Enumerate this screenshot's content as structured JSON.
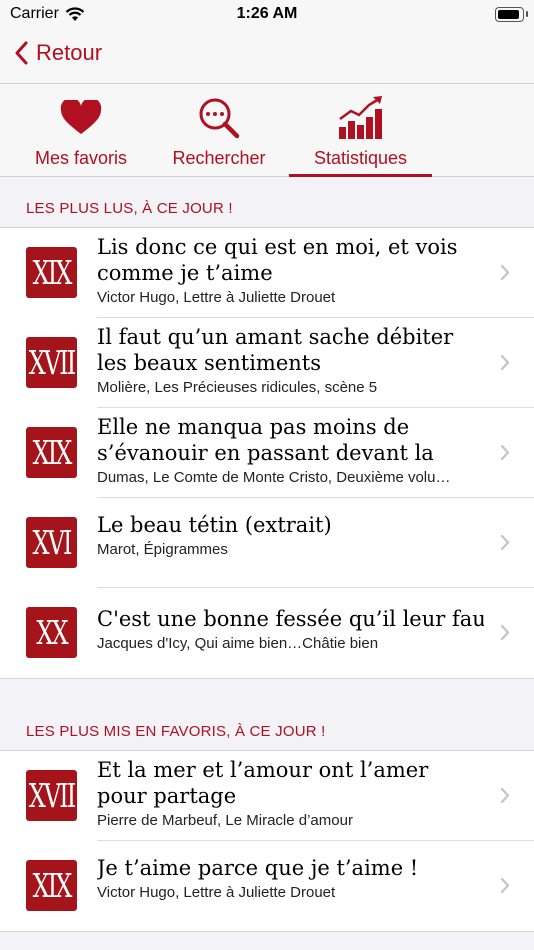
{
  "status": {
    "carrier": "Carrier",
    "time": "1:26 AM"
  },
  "nav": {
    "back_label": "Retour"
  },
  "tabs": [
    {
      "label": "Mes favoris",
      "icon": "heart-icon"
    },
    {
      "label": "Rechercher",
      "icon": "search-icon"
    },
    {
      "label": "Statistiques",
      "icon": "stats-icon",
      "selected": true
    }
  ],
  "colors": {
    "accent": "#b01020",
    "badge": "#a5141a"
  },
  "sections": [
    {
      "header": "LES PLUS LUS, À CE JOUR !",
      "items": [
        {
          "badge": "XIX",
          "title": "Lis donc ce qui est en moi, et vois comme je t’aime",
          "subtitle": "Victor Hugo, Lettre à Juliette Drouet"
        },
        {
          "badge": "XVII",
          "title": "Il faut qu’un amant sache débiter les beaux sentiments",
          "subtitle": "Molière, Les Précieuses ridicules, scène 5"
        },
        {
          "badge": "XIX",
          "title": "Elle ne manqua pas moins de s’évanouir en passant devant la Rés…",
          "subtitle": "Dumas, Le Comte de Monte Cristo, Deuxième volu…"
        },
        {
          "badge": "XVI",
          "title": "Le beau tétin (extrait)",
          "subtitle": "Marot, Épigrammes"
        },
        {
          "badge": "XX",
          "title": "C'est une bonne fessée qu’il leur  faut",
          "subtitle": "Jacques d'Icy, Qui aime bien…Châtie bien"
        }
      ]
    },
    {
      "header": "LES PLUS MIS EN FAVORIS, À CE JOUR !",
      "items": [
        {
          "badge": "XVII",
          "title": "Et la mer et l’amour ont l’amer pour partage",
          "subtitle": "Pierre de Marbeuf, Le Miracle d’amour"
        },
        {
          "badge": "XIX",
          "title": "Je t’aime parce que je t’aime !",
          "subtitle": "Victor Hugo, Lettre à Juliette Drouet"
        }
      ]
    }
  ]
}
